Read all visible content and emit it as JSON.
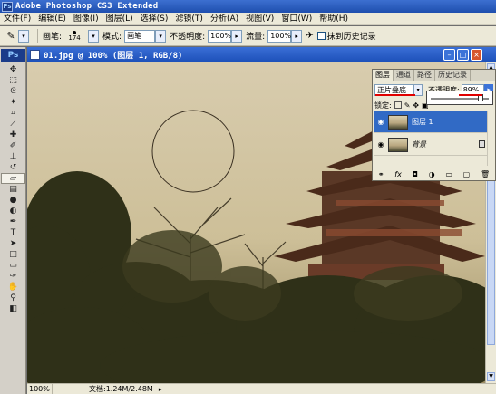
{
  "app": {
    "title": "Adobe Photoshop CS3 Extended",
    "logo_text": "Ps"
  },
  "menu": [
    "文件(F)",
    "编辑(E)",
    "图像(I)",
    "图层(L)",
    "选择(S)",
    "滤镜(T)",
    "分析(A)",
    "视图(V)",
    "窗口(W)",
    "帮助(H)"
  ],
  "options": {
    "brush_label": "画笔:",
    "brush_size": "174",
    "mode_label": "模式:",
    "mode_value": "画笔",
    "opacity_label": "不透明度:",
    "opacity_value": "100%",
    "flow_label": "流量:",
    "flow_value": "100%",
    "history_label": "抹到历史记录"
  },
  "document": {
    "title": "01.jpg @ 100% (图层 1, RGB/8)",
    "zoom": "100%",
    "doc_info": "文档:1.24M/2.48M"
  },
  "layers_panel": {
    "tabs": [
      "图层",
      "通道",
      "路径",
      "历史记录"
    ],
    "blend_mode": "正片叠底",
    "opacity_label": "不透明度:",
    "opacity_value": "89%",
    "lock_label": "锁定:",
    "layers": [
      {
        "name": "图层 1",
        "selected": true
      },
      {
        "name": "背景",
        "selected": false
      }
    ]
  },
  "colors": {
    "titlebar": "#2a5cc2",
    "selection": "#316ac5",
    "annotation": "#e00000"
  }
}
